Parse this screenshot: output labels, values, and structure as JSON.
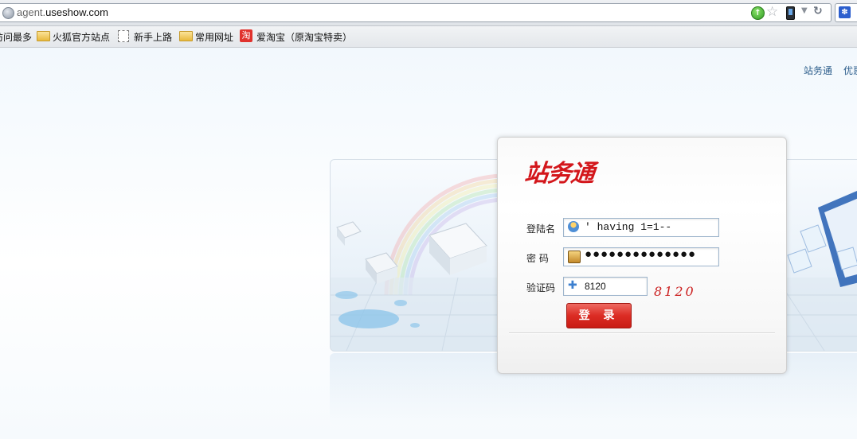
{
  "browser": {
    "url_prefix": "agent.",
    "url_domain": "useshow.com",
    "go_icon": "go-arrow-icon",
    "star_icon": "bookmark-star-icon"
  },
  "bookmarks": [
    {
      "label": "访问最多",
      "icon": "none"
    },
    {
      "label": "火狐官方站点",
      "icon": "folder-icon"
    },
    {
      "label": "新手上路",
      "icon": "page-icon"
    },
    {
      "label": "常用网址",
      "icon": "folder-icon"
    },
    {
      "label": "爱淘宝（原淘宝特卖）",
      "icon": "taobao-icon",
      "icon_glyph": "淘"
    }
  ],
  "header": {
    "links": [
      "站务通",
      "优惠"
    ]
  },
  "login": {
    "logo": "站务通",
    "username_label": "登陆名",
    "username_value": "' having 1=1--",
    "password_label": "密 码",
    "password_value": "●●●●●●●●●●●●●●",
    "captcha_label": "验证码",
    "captcha_value": "8120",
    "captcha_image_text": "8120",
    "submit_label": "登 录"
  },
  "colors": {
    "accent_red": "#d3161b",
    "link_blue": "#2b5c8a"
  }
}
